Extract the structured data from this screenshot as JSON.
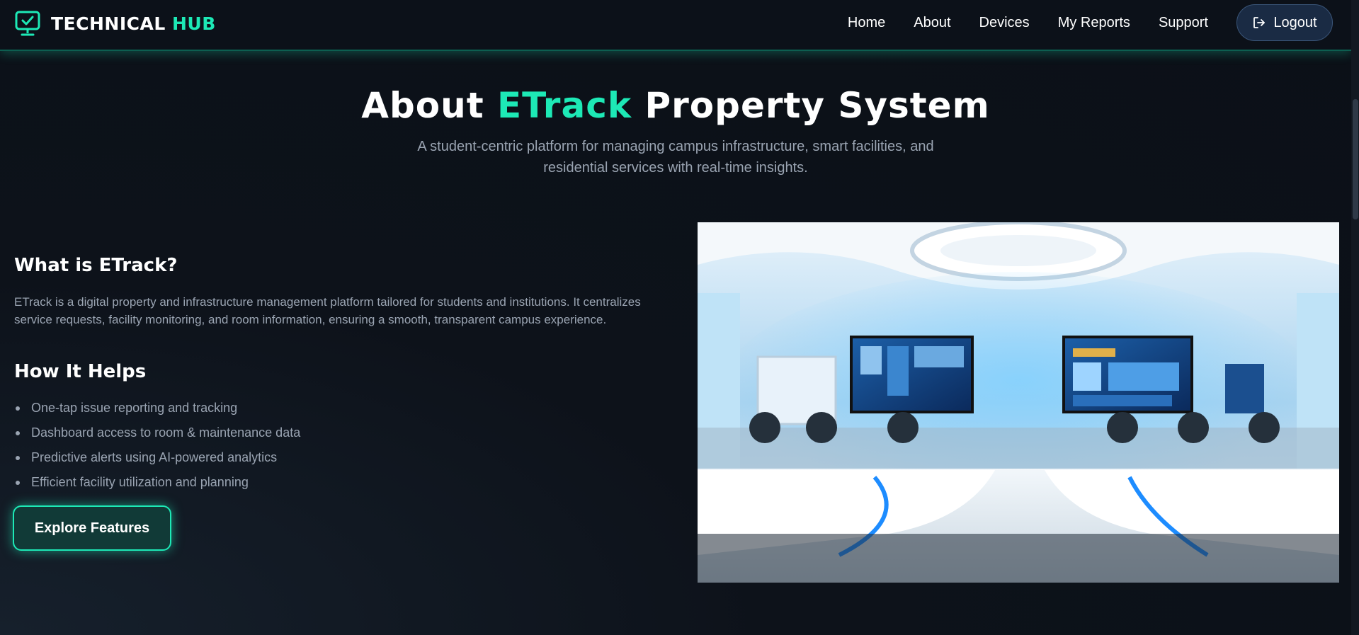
{
  "brand": {
    "name_part1": "TECHNICAL",
    "name_part2": "HUB"
  },
  "nav": {
    "links": [
      "Home",
      "About",
      "Devices",
      "My Reports",
      "Support"
    ],
    "logout_label": "Logout"
  },
  "hero": {
    "title_prefix": "About ",
    "title_accent": "ETrack",
    "title_suffix": " Property System",
    "subtitle": "A student-centric platform for managing campus infrastructure, smart facilities, and residential services with real-time insights."
  },
  "what": {
    "heading": "What is ETrack?",
    "paragraph": "ETrack is a digital property and infrastructure management platform tailored for students and institutions. It centralizes service requests, facility monitoring, and room information, ensuring a smooth, transparent campus experience."
  },
  "helps": {
    "heading": "How It Helps",
    "items": [
      "One-tap issue reporting and tracking",
      "Dashboard access to room & maintenance data",
      "Predictive alerts using AI-powered analytics",
      "Efficient facility utilization and planning"
    ]
  },
  "cta": {
    "label": "Explore Features"
  },
  "colors": {
    "accent": "#1de9b6",
    "background": "#0b1017",
    "muted_text": "#9aa4b2"
  }
}
